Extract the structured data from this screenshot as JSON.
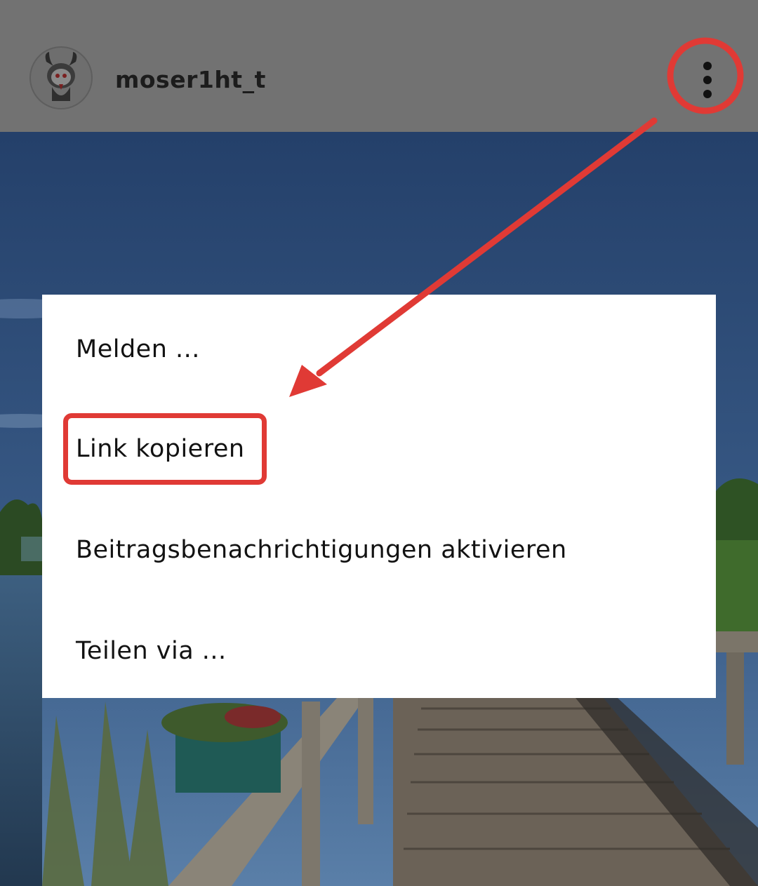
{
  "header": {
    "username": "moser1ht_t"
  },
  "menu": {
    "items": [
      {
        "label": "Melden ..."
      },
      {
        "label": "Link kopieren"
      },
      {
        "label": "Beitragsbenachrichtigungen aktivieren"
      },
      {
        "label": "Teilen via ..."
      }
    ]
  },
  "icons": {
    "more": "vertical-dots-icon",
    "avatar": "devil-avatar-icon"
  },
  "colors": {
    "annotation_red": "#e03a35",
    "header_bg": "#727272",
    "menu_bg": "#ffffff"
  }
}
